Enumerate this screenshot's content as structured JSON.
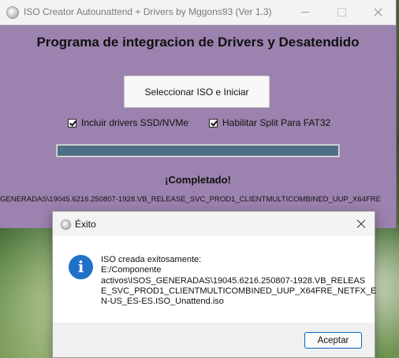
{
  "window": {
    "title": "ISO Creator Autounattend + Drivers by Mggons93 (Ver 1.3)",
    "background_color": "#9c82ae"
  },
  "main": {
    "heading": "Programa de integracion de Drivers y Desatendido",
    "select_button_label": "Seleccionar ISO e Iniciar",
    "checkbox_ssd": {
      "label": "Incluir drivers SSD/NVMe",
      "checked": true
    },
    "checkbox_split": {
      "label": "Habilitar Split Para FAT32",
      "checked": true
    },
    "progress_percent": 100,
    "status_text": "¡Completado!",
    "path_text": "GENERADAS\\19045.6216.250807-1928.VB_RELEASE_SVC_PROD1_CLIENTMULTICOMBINED_UUP_X64FRE"
  },
  "dialog": {
    "title": "Éxito",
    "icon": "info-icon",
    "message_lines": [
      "ISO creada exitosamente:",
      "E:/Componente",
      "activos\\ISOS_GENERADAS\\19045.6216.250807-1928.VB_RELEAS",
      "E_SVC_PROD1_CLIENTMULTICOMBINED_UUP_X64FRE_NETFX_E",
      "N-US_ES-ES.ISO_Unattend.iso"
    ],
    "accept_label": "Aceptar",
    "accent_color": "#0067c0"
  }
}
